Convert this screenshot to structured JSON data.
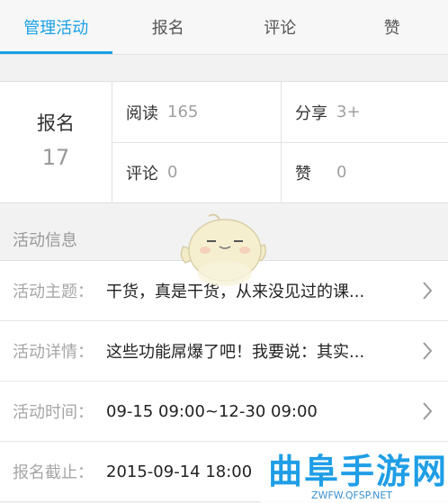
{
  "tabs": [
    {
      "label": "管理活动",
      "active": true
    },
    {
      "label": "报名",
      "active": false
    },
    {
      "label": "评论",
      "active": false
    },
    {
      "label": "赞",
      "active": false
    }
  ],
  "stats": {
    "signup_label": "报名",
    "signup_count": "17",
    "read_label": "阅读",
    "read_count": "165",
    "share_label": "分享",
    "share_count": "3+",
    "comment_label": "评论",
    "comment_count": "0",
    "like_label": "赞",
    "like_count": "0"
  },
  "section_title": "活动信息",
  "info": [
    {
      "label": "活动主题：",
      "value": "干货，真是干货，从来没见过的课..."
    },
    {
      "label": "活动详情：",
      "value": "这些功能屌爆了吧！我要说：其实..."
    },
    {
      "label": "活动时间：",
      "value": "09-15 09:00~12-30 09:00"
    },
    {
      "label": "报名截止：",
      "value": "2015-09-14 18:00"
    }
  ],
  "colors": {
    "accent": "#1aa0e6"
  },
  "watermark": {
    "title": "曲阜手游网",
    "url": "ZWFW.QFSP.NET"
  }
}
